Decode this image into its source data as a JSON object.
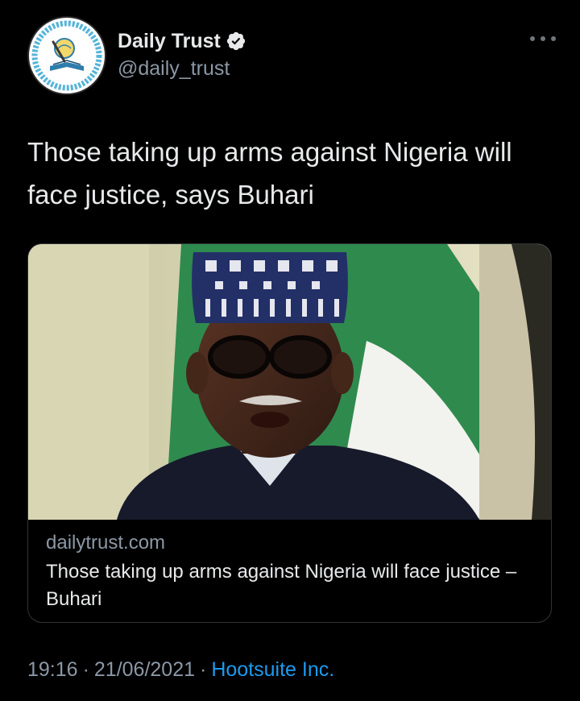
{
  "account": {
    "display_name": "Daily Trust",
    "handle": "@daily_trust",
    "verified": true,
    "avatar_icon": "daily-trust-logo-icon"
  },
  "menu": {
    "icon": "more-options-icon"
  },
  "tweet": {
    "text": "Those taking up arms against Nigeria will face justice, says Buhari"
  },
  "link_card": {
    "image_description_icon": "article-photo",
    "domain": "dailytrust.com",
    "title": "Those taking up arms against Nigeria will face justice – Buhari"
  },
  "meta": {
    "time": "19:16",
    "date": "21/06/2021",
    "separator": "·",
    "source": "Hootsuite Inc."
  },
  "colors": {
    "background": "#000000",
    "text": "#e7e9ea",
    "secondary_text": "#8b98a5",
    "link": "#1d9bf0",
    "card_border": "#2f3336",
    "verified_badge": "#e7e9ea"
  }
}
